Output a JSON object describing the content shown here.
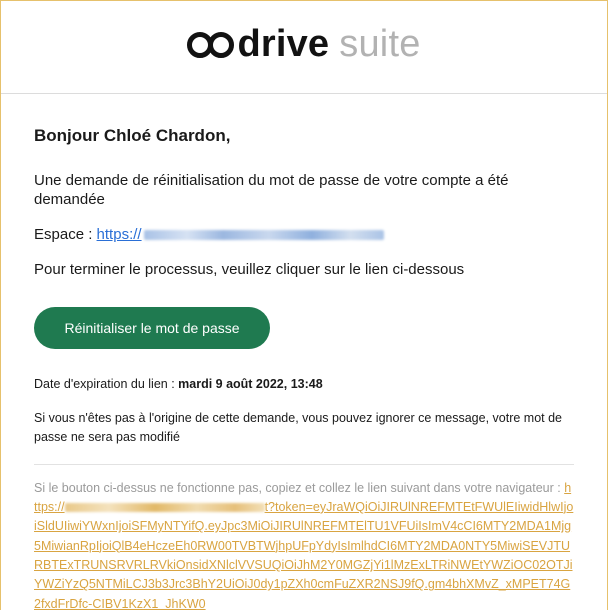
{
  "logo": {
    "brand": "drive",
    "suite": "suite"
  },
  "email": {
    "greeting": "Bonjour Chloé Chardon,",
    "request_text": "Une demande de réinitialisation du mot de passe de votre compte a été demandée",
    "space_label": "Espace : ",
    "space_link_prefix": "https://",
    "instruction": "Pour terminer le processus, veuillez cliquer sur le lien ci-dessous",
    "reset_button": "Réinitialiser le mot de passe",
    "expiry_label": "Date d'expiration du lien : ",
    "expiry_date": "mardi 9 août 2022, 13:48",
    "ignore_text": "Si vous n'êtes pas à l'origine de cette demande, vous pouvez ignorer ce message, votre mot de passe ne sera pas modifié",
    "fallback_text": "Si le bouton ci-dessus ne fonctionne pas, copiez et collez le lien suivant dans votre navigateur : ",
    "fallback_link_start": "https://",
    "fallback_link_rest": "t?token=eyJraWQiOiJIRUlNREFMTEtFWUlEIiwidHlwIjoiSldUIiwiYWxnIjoiSFMyNTYifQ.eyJpc3MiOiJIRUlNREFMTElTU1VFUiIsImV4cCI6MTY2MDA1Mjg5MiwianRpIjoiQlB4eHczeEh0RW00TVBTWjhpUFpYdyIsImlhdCI6MTY2MDA0NTY5MiwiSEVJTURBTExTRUNSRVRLRVkiOnsidXNlclVVSUQiOiJhM2Y0MGZjYi1lMzExLTRiNWEtYWZiOC02OTJiYWZiYzQ5NTMiLCJ3b3Jrc3BhY2UiOiJ0dy1pZXh0cmFuZXR2NSJ9fQ.gm4bhXMvZ_xMPET74G2fxdFrDfc-CIBV1KzX1_JhKW0"
  },
  "colors": {
    "button_bg": "#1f7a50",
    "link_blue": "#2a6fd6",
    "fallback_link": "#d9a441",
    "frame_border": "#e6c16c"
  }
}
